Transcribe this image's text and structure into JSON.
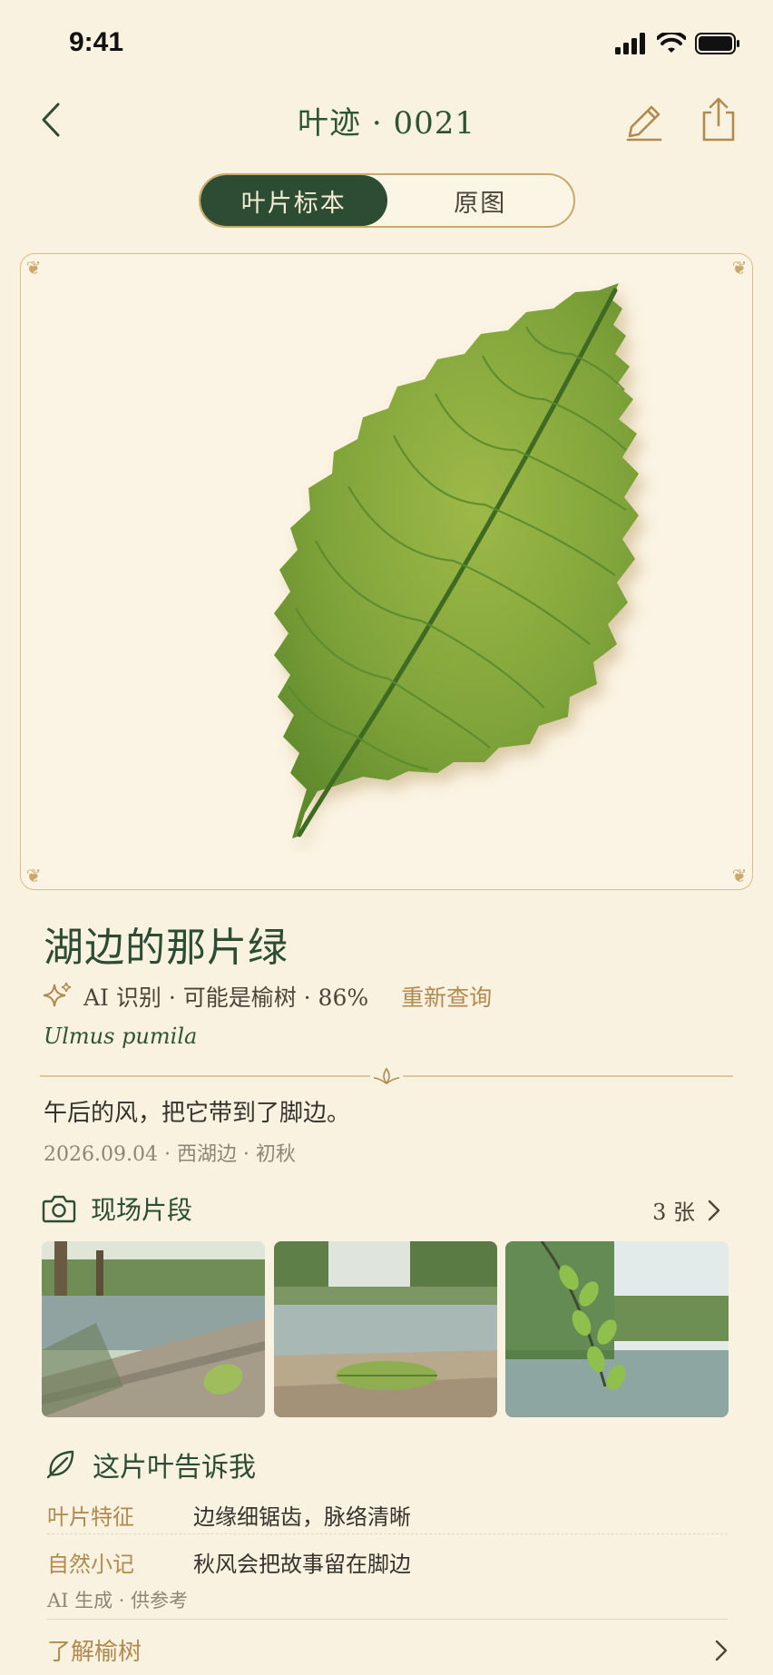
{
  "status_bar": {
    "time": "9:41"
  },
  "nav": {
    "title": "叶迹 · 0021"
  },
  "segment": {
    "active": "叶片标本",
    "inactive": "原图"
  },
  "leaf": {
    "title": "湖边的那片绿",
    "ai_text": "AI 识别 · 可能是榆树 · 86%",
    "requery": "重新查询",
    "latin_name": "Ulmus pumila",
    "note": "午后的风，把它带到了脚边。",
    "meta": "2026.09.04 · 西湖边 · 初秋"
  },
  "scene": {
    "title": "现场片段",
    "count": "3 张"
  },
  "tells": {
    "title": "这片叶告诉我",
    "rows": [
      {
        "key": "叶片特征",
        "value": "边缘细锯齿，脉络清晰"
      },
      {
        "key": "自然小记",
        "value": "秋风会把故事留在脚边"
      }
    ],
    "ai_generated": "AI 生成 · 供参考",
    "learn_more": "了解榆树"
  },
  "colors": {
    "background": "#faf2e0",
    "accent_green": "#2c4d34",
    "accent_gold": "#b08a4e",
    "leaf_green": "#7fa33a"
  },
  "icons": [
    "back-chevron-icon",
    "pencil-icon",
    "share-icon",
    "sparkle-icon",
    "camera-icon",
    "leaf-icon",
    "chevron-right-icon",
    "signal-icon",
    "wifi-icon",
    "battery-icon"
  ]
}
